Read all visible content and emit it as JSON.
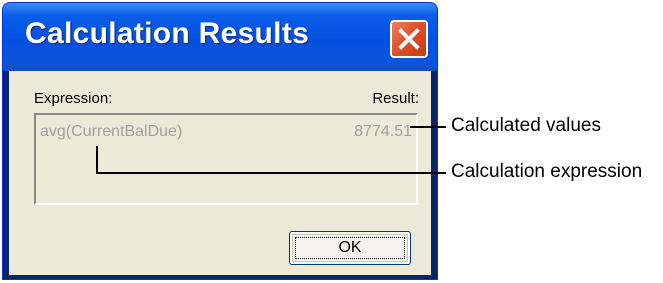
{
  "dialog": {
    "title": "Calculation Results",
    "expression_header": "Expression:",
    "result_header": "Result:",
    "rows": [
      {
        "expression": "avg(CurrentBalDue)",
        "result": "8774.51"
      }
    ],
    "ok_label": "OK",
    "close_icon": "close-icon"
  },
  "callouts": {
    "values": "Calculated values",
    "expression": "Calculation expression"
  },
  "colors": {
    "titlebar_blue": "#0550e0",
    "close_red": "#e0502a",
    "dialog_face": "#ece9d8",
    "disabled_text": "#a0a0a0"
  }
}
